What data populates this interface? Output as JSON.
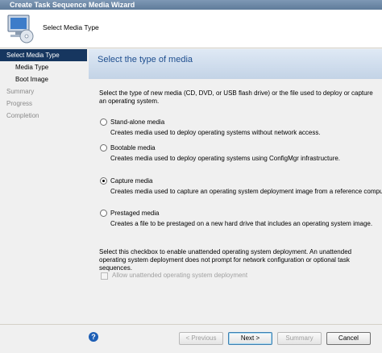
{
  "window": {
    "title": "Create Task Sequence Media Wizard"
  },
  "header": {
    "title": "Select Media Type",
    "icon": "computer-media-icon"
  },
  "sidebar": {
    "items": [
      {
        "label": "Select Media Type",
        "state": "active"
      },
      {
        "label": "Media Type",
        "state": "sub"
      },
      {
        "label": "Boot Image",
        "state": "sub"
      },
      {
        "label": "Summary",
        "state": "disabled"
      },
      {
        "label": "Progress",
        "state": "disabled"
      },
      {
        "label": "Completion",
        "state": "disabled"
      }
    ]
  },
  "main": {
    "title": "Select the type of media",
    "description": "Select the type of new media (CD, DVD, or USB flash drive) or the file used to deploy or capture an operating system.",
    "options": [
      {
        "label": "Stand-alone media",
        "description": "Creates media used to deploy operating systems without network access.",
        "selected": false
      },
      {
        "label": "Bootable media",
        "description": "Creates media used to deploy operating systems using ConfigMgr infrastructure.",
        "selected": false
      },
      {
        "label": "Capture media",
        "description": "Creates media used to capture an operating system deployment image from a reference computer.",
        "selected": true
      },
      {
        "label": "Prestaged media",
        "description": "Creates a file to be prestaged on a new hard drive that includes an operating system image.",
        "selected": false
      }
    ],
    "unattended_note": "Select this checkbox to enable unattended operating system deployment. An unattended operating system deployment does not prompt for network configuration or optional task sequences.",
    "unattended_checkbox": {
      "label": "Allow unattended operating system deployment",
      "checked": false,
      "enabled": false
    }
  },
  "footer": {
    "help_icon": "help-icon",
    "previous": "< Previous",
    "next": "Next >",
    "summary": "Summary",
    "cancel": "Cancel"
  },
  "colors": {
    "active_nav": "#16365f",
    "banner_title": "#1f4f8f",
    "banner_top": "#dfe9f5",
    "banner_bottom": "#c3d3e6"
  }
}
